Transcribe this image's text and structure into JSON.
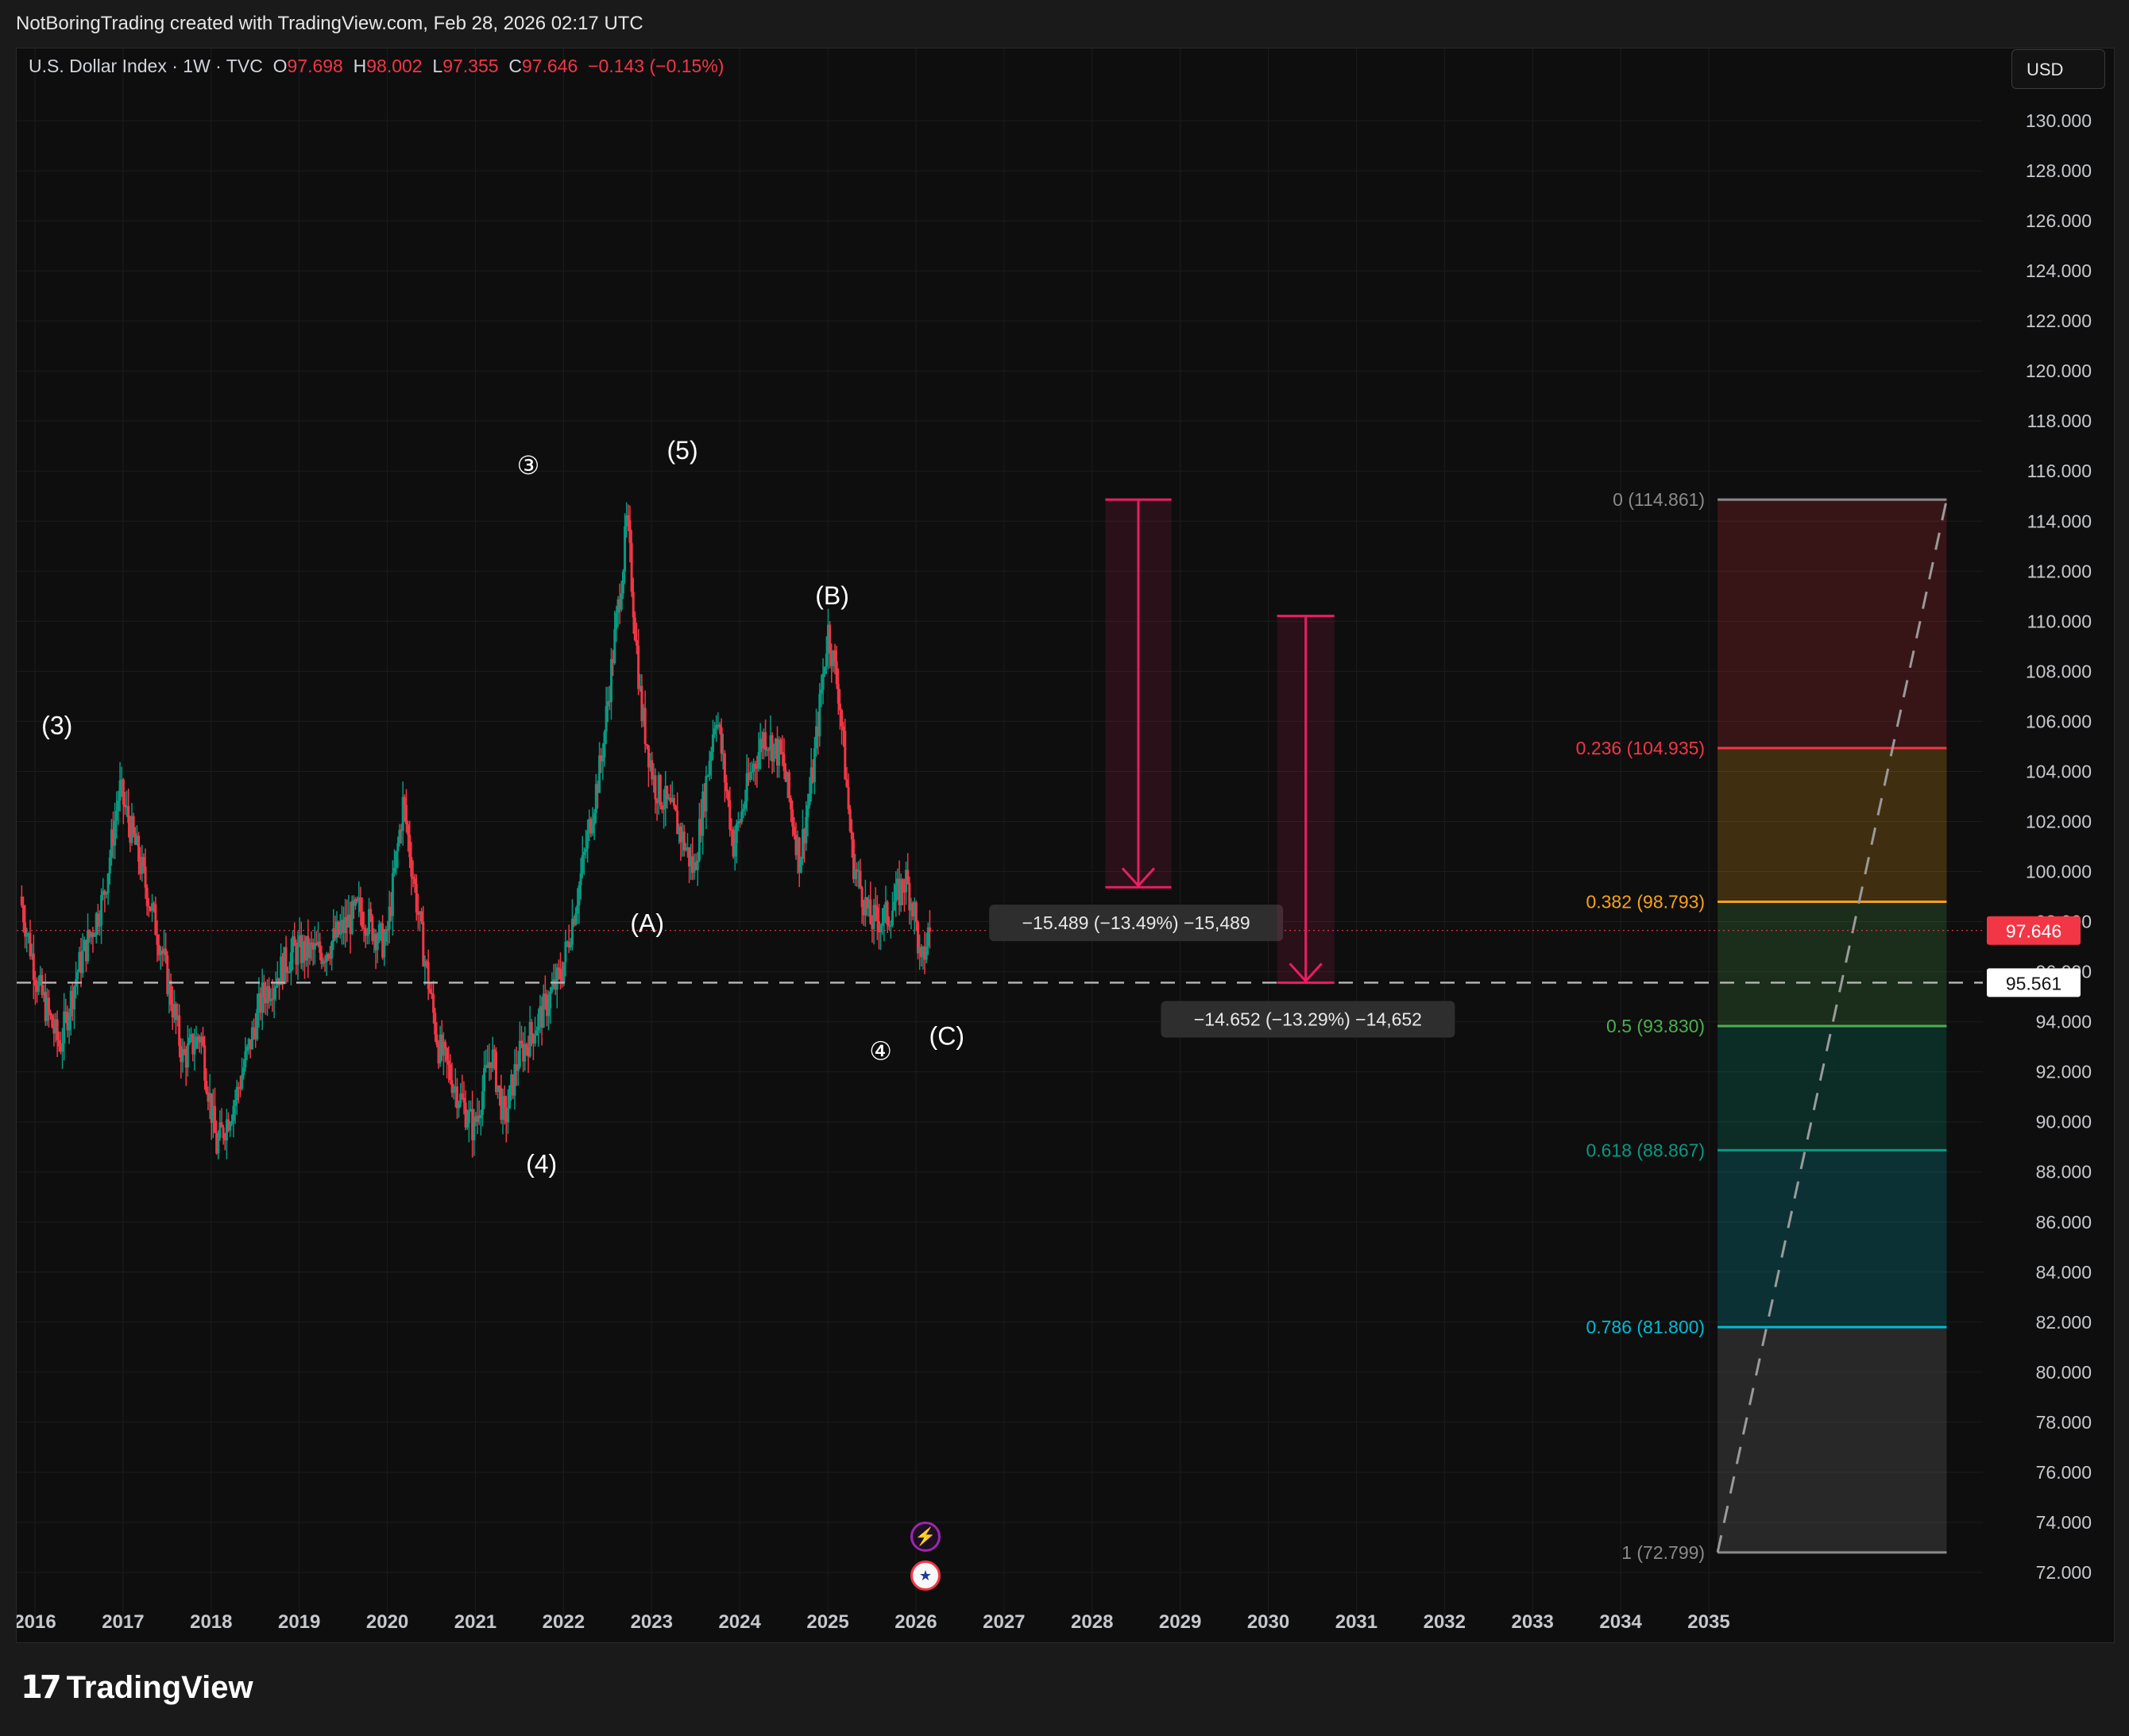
{
  "header": {
    "text": "NotBoringTrading created with TradingView.com, Feb 28, 2026 02:17 UTC"
  },
  "legend": {
    "symbol": "U.S. Dollar Index · 1W · TVC",
    "open_label": "O",
    "open": "97.698",
    "high_label": "H",
    "high": "98.002",
    "low_label": "L",
    "low": "97.355",
    "close_label": "C",
    "close": "97.646",
    "change": "−0.143 (−0.15%)"
  },
  "currency_button": "USD",
  "brand": {
    "logo_mark": "17",
    "name": "TradingView"
  },
  "colors": {
    "up": "#089981",
    "down": "#f23645",
    "background": "#0e0e0e",
    "fib_red": "#f23645",
    "fib_orange": "#f7a21b",
    "fib_green": "#4caf50",
    "fib_teal": "#089981",
    "fib_cyan": "#00bcd4"
  },
  "events": {
    "flash_icon": "lightning-icon",
    "us_flag_icon": "us-flag-icon"
  },
  "chart_data": {
    "type": "candlestick",
    "ylim": [
      71,
      132
    ],
    "xlim": [
      2015.85,
      2035.6
    ],
    "y_ticks": [
      "130.000",
      "128.000",
      "126.000",
      "124.000",
      "122.000",
      "120.000",
      "118.000",
      "116.000",
      "114.000",
      "112.000",
      "110.000",
      "108.000",
      "106.000",
      "104.000",
      "102.000",
      "100.000",
      "98.000",
      "96.000",
      "94.000",
      "92.000",
      "90.000",
      "88.000",
      "86.000",
      "84.000",
      "82.000",
      "80.000",
      "78.000",
      "76.000",
      "74.000",
      "72.000"
    ],
    "x_ticks": [
      "2016",
      "2017",
      "2018",
      "2019",
      "2020",
      "2021",
      "2022",
      "2023",
      "2024",
      "2025",
      "2026",
      "2027",
      "2028",
      "2029",
      "2030",
      "2031",
      "2032",
      "2033",
      "2034",
      "2035"
    ],
    "price_anchors": [
      [
        2015.85,
        99.0
      ],
      [
        2016.05,
        95.5
      ],
      [
        2016.3,
        93.0
      ],
      [
        2016.5,
        96.0
      ],
      [
        2016.8,
        99.0
      ],
      [
        2016.98,
        103.3
      ],
      [
        2017.2,
        100.5
      ],
      [
        2017.45,
        97.0
      ],
      [
        2017.7,
        92.5
      ],
      [
        2017.9,
        93.5
      ],
      [
        2018.08,
        89.0
      ],
      [
        2018.3,
        91.0
      ],
      [
        2018.6,
        95.0
      ],
      [
        2018.95,
        96.8
      ],
      [
        2019.3,
        96.8
      ],
      [
        2019.7,
        98.5
      ],
      [
        2020.0,
        97.0
      ],
      [
        2020.2,
        102.8
      ],
      [
        2020.4,
        97.5
      ],
      [
        2020.6,
        93.0
      ],
      [
        2020.9,
        90.5
      ],
      [
        2021.0,
        89.7
      ],
      [
        2021.2,
        92.8
      ],
      [
        2021.35,
        90.0
      ],
      [
        2021.5,
        92.5
      ],
      [
        2021.8,
        94.5
      ],
      [
        2022.0,
        96.0
      ],
      [
        2022.2,
        99.5
      ],
      [
        2022.45,
        104.5
      ],
      [
        2022.7,
        112.5
      ],
      [
        2022.74,
        114.1
      ],
      [
        2022.9,
        106.5
      ],
      [
        2023.05,
        103.5
      ],
      [
        2023.3,
        102.0
      ],
      [
        2023.5,
        100.0
      ],
      [
        2023.75,
        106.5
      ],
      [
        2023.95,
        101.0
      ],
      [
        2024.15,
        104.0
      ],
      [
        2024.3,
        105.5
      ],
      [
        2024.5,
        104.5
      ],
      [
        2024.7,
        100.5
      ],
      [
        2024.85,
        104.0
      ],
      [
        2025.02,
        109.7
      ],
      [
        2025.15,
        107.0
      ],
      [
        2025.3,
        100.5
      ],
      [
        2025.5,
        98.0
      ],
      [
        2025.7,
        98.2
      ],
      [
        2025.9,
        99.7
      ],
      [
        2026.0,
        98.5
      ],
      [
        2026.08,
        96.0
      ],
      [
        2026.16,
        97.6
      ]
    ],
    "last_price": 97.646,
    "last_price_label": "97.646",
    "horizontal_line": {
      "value": 95.561,
      "label": "95.561"
    },
    "wave_labels": [
      {
        "text": "(3)",
        "x": 2016.25,
        "y": 105.8
      },
      {
        "text": "③",
        "x": 2021.6,
        "y": 116.2
      },
      {
        "text": "(5)",
        "x": 2023.35,
        "y": 116.8
      },
      {
        "text": "(B)",
        "x": 2025.05,
        "y": 111.0
      },
      {
        "text": "(A)",
        "x": 2022.95,
        "y": 97.9
      },
      {
        "text": "(4)",
        "x": 2021.75,
        "y": 88.3
      },
      {
        "text": "④",
        "x": 2025.6,
        "y": 92.8
      },
      {
        "text": "(C)",
        "x": 2026.35,
        "y": 93.4
      }
    ],
    "measures": [
      {
        "from": 114.861,
        "to": 99.372,
        "x1": 2028.15,
        "x2": 2028.9,
        "label": "−15.489 (−13.49%) −15,489",
        "label_x": 2028.5,
        "label_y": 97.95
      },
      {
        "from": 110.213,
        "to": 95.561,
        "x1": 2030.1,
        "x2": 2030.75,
        "label": "−14.652 (−13.29%) −14,652",
        "label_x": 2030.45,
        "label_y": 94.1
      }
    ],
    "fib": {
      "x1": 2035.1,
      "x2": 2037.7,
      "levels": [
        {
          "ratio": "0",
          "value": 114.861,
          "label": "0 (114.861)",
          "color": "#8a8a8a"
        },
        {
          "ratio": "0.236",
          "value": 104.935,
          "label": "0.236 (104.935)",
          "color": "#f23645"
        },
        {
          "ratio": "0.382",
          "value": 98.793,
          "label": "0.382 (98.793)",
          "color": "#f7a21b"
        },
        {
          "ratio": "0.5",
          "value": 93.83,
          "label": "0.5 (93.830)",
          "color": "#4caf50"
        },
        {
          "ratio": "0.618",
          "value": 88.867,
          "label": "0.618 (88.867)",
          "color": "#089981"
        },
        {
          "ratio": "0.786",
          "value": 81.8,
          "label": "0.786 (81.800)",
          "color": "#00bcd4"
        },
        {
          "ratio": "1",
          "value": 72.799,
          "label": "1 (72.799)",
          "color": "#8a8a8a"
        }
      ]
    }
  }
}
